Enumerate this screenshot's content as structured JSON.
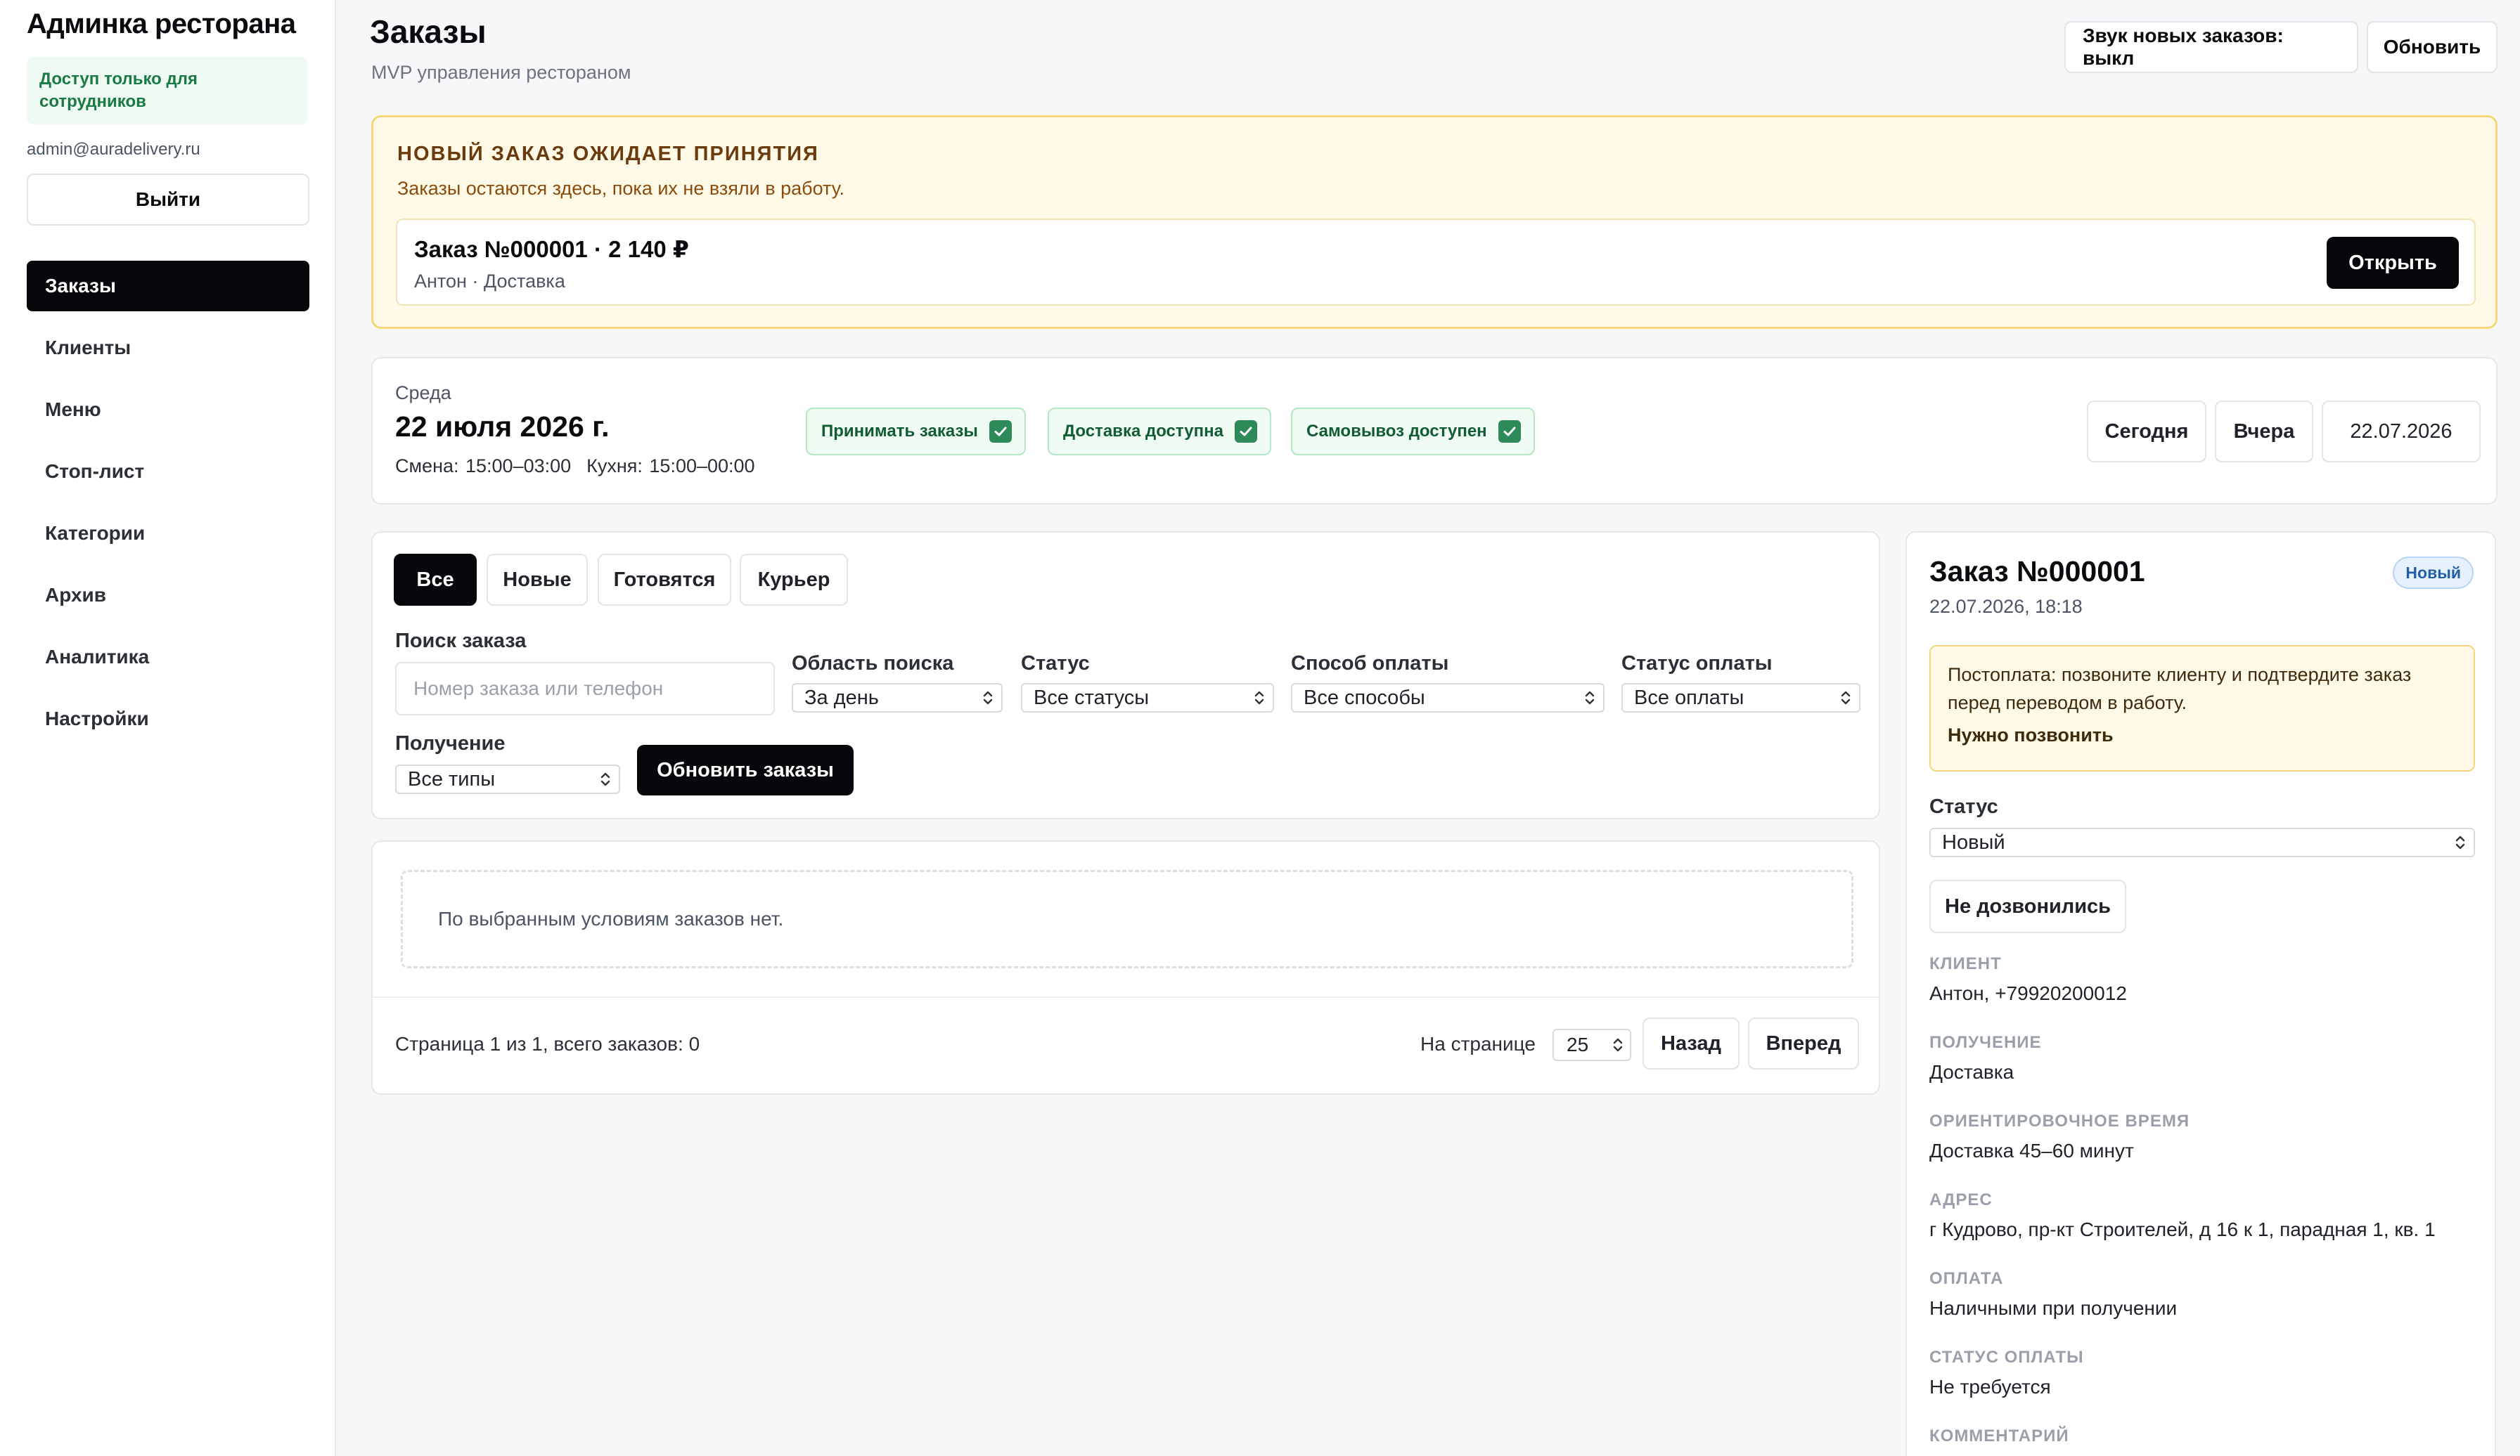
{
  "sidebar": {
    "brand": "Админка ресторана",
    "staff_note": "Доступ только для сотрудников",
    "email": "admin@auradelivery.ru",
    "logout_label": "Выйти",
    "items": [
      {
        "label": "Заказы",
        "active": true
      },
      {
        "label": "Клиенты"
      },
      {
        "label": "Меню"
      },
      {
        "label": "Стоп-лист"
      },
      {
        "label": "Категории"
      },
      {
        "label": "Архив"
      },
      {
        "label": "Аналитика"
      },
      {
        "label": "Настройки"
      }
    ]
  },
  "header": {
    "title": "Заказы",
    "subtitle": "MVP управления рестораном",
    "sound_button": "Звук новых заказов: выкл",
    "refresh_button": "Обновить"
  },
  "alert": {
    "title": "НОВЫЙ ЗАКАЗ ОЖИДАЕТ ПРИНЯТИЯ",
    "text": "Заказы остаются здесь, пока их не взяли в работу.",
    "order_title": "Заказ №000001 · 2 140 ₽",
    "order_sub": "Антон · Доставка",
    "open_button": "Открыть"
  },
  "day": {
    "weekday": "Среда",
    "date": "22 июля 2026 г.",
    "shift": "Смена: 15:00–03:00",
    "kitchen": "Кухня: 15:00–00:00",
    "pills": [
      "Принимать заказы",
      "Доставка доступна",
      "Самовывоз доступен"
    ],
    "today_button": "Сегодня",
    "yesterday_button": "Вчера",
    "date_value": "22.07.2026"
  },
  "filters": {
    "tabs": [
      "Все",
      "Новые",
      "Готовятся",
      "Курьер"
    ],
    "search_label": "Поиск заказа",
    "search_placeholder": "Номер заказа или телефон",
    "scope_label": "Область поиска",
    "scope_value": "За день",
    "status_label": "Статус",
    "status_value": "Все статусы",
    "payment_label": "Способ оплаты",
    "payment_value": "Все способы",
    "payment_status_label": "Статус оплаты",
    "payment_status_value": "Все оплаты",
    "delivery_label": "Получение",
    "delivery_value": "Все типы",
    "refresh_orders_button": "Обновить заказы"
  },
  "list": {
    "empty_text": "По выбранным условиям заказов нет.",
    "pager_text": "Страница 1 из 1, всего заказов: 0",
    "per_page_label": "На странице",
    "per_page_value": "25",
    "prev_button": "Назад",
    "next_button": "Вперед"
  },
  "detail": {
    "title": "Заказ №000001",
    "datetime": "22.07.2026, 18:18",
    "badge": "Новый",
    "warning": "Постоплата: позвоните клиенту и подтвердите заказ перед переводом в работу.",
    "warning_strong": "Нужно позвонить",
    "status_label": "Статус",
    "status_value": "Новый",
    "no_answer_button": "Не дозвонились",
    "fields": [
      {
        "label": "КЛИЕНТ",
        "value": "Антон, +79920200012"
      },
      {
        "label": "ПОЛУЧЕНИЕ",
        "value": "Доставка"
      },
      {
        "label": "ОРИЕНТИРОВОЧНОЕ ВРЕМЯ",
        "value": "Доставка 45–60 минут"
      },
      {
        "label": "АДРЕС",
        "value": "г Кудрово, пр-кт Строителей, д 16 к 1, парадная 1, кв. 1"
      },
      {
        "label": "ОПЛАТА",
        "value": "Наличными при получении"
      },
      {
        "label": "СТАТУС ОПЛАТЫ",
        "value": "Не требуется"
      },
      {
        "label": "КОММЕНТАРИЙ",
        "value": ""
      }
    ]
  }
}
